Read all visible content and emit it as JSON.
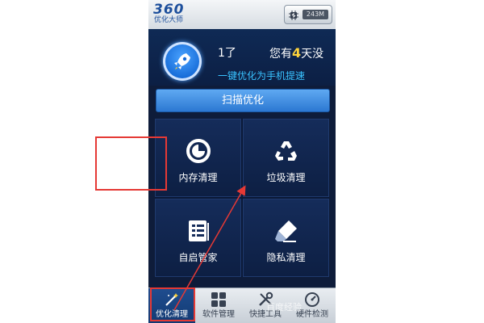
{
  "header": {
    "logo_text": "360",
    "logo_subtitle": "优化大师",
    "memory_indicator": "243M"
  },
  "hero": {
    "greeting_left": "1了",
    "greeting_right_prefix": "您有",
    "greeting_days": "4",
    "greeting_right_suffix": "天没",
    "tagline": "一键优化为手机提速"
  },
  "scan_button_label": "扫描优化",
  "tiles": [
    {
      "label": "内存清理",
      "icon": "memory-clean-icon"
    },
    {
      "label": "垃圾清理",
      "icon": "recycle-icon"
    },
    {
      "label": "自启管家",
      "icon": "autostart-list-icon"
    },
    {
      "label": "隐私清理",
      "icon": "eraser-icon"
    }
  ],
  "bottom_nav": [
    {
      "label": "优化清理",
      "icon": "magic-wand-icon",
      "active": true
    },
    {
      "label": "软件管理",
      "icon": "app-grid-icon",
      "active": false
    },
    {
      "label": "快捷工具",
      "icon": "tools-icon",
      "active": false
    },
    {
      "label": "硬件检测",
      "icon": "hardware-check-icon",
      "active": false
    }
  ],
  "watermark": "百度经验",
  "colors": {
    "background": "#0e1c3a",
    "accent_blue": "#2c78d2",
    "highlight_red": "#e53935",
    "days_yellow": "#ffd43b",
    "tagline_cyan": "#39c3ff"
  }
}
